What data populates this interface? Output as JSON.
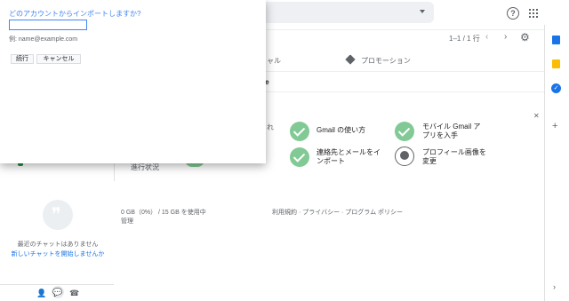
{
  "dialog": {
    "title": "どのアカウントからインポートしますか?",
    "input_value": "",
    "example": "例: name@example.com",
    "continue_label": "続行",
    "cancel_label": "キャンセル"
  },
  "toolbar": {
    "pager": "1–1 / 1 行"
  },
  "tabs": {
    "social_fragment": "ャル",
    "promotions": "プロモーション"
  },
  "message_row": {
    "sender_fragment": "gle"
  },
  "setup": {
    "left_fragment": "れ",
    "items": [
      {
        "label": "Gmail の使い方",
        "done": true
      },
      {
        "label": "モバイル Gmail アプリを入手",
        "done": true
      },
      {
        "label": "連絡先とメールをインポート",
        "done": true
      },
      {
        "label": "プロフィール画像を変更",
        "done": false
      }
    ],
    "status": "進行状況"
  },
  "footer": {
    "storage": "0 GB（0%） / 15 GB を使用中",
    "manage": "管理",
    "links": "利用規約 · プライバシー · プログラム ポリシー"
  },
  "chat": {
    "empty": "最近のチャットはありません",
    "start": "新しいチャットを開始しませんか"
  },
  "colors": {
    "accent_blue": "#4285f4",
    "done_green": "#81c995"
  },
  "icons": [
    "help-icon",
    "apps-icon",
    "settings-icon",
    "label-icon",
    "hangouts-icon",
    "person-icon",
    "chat-icon",
    "phone-icon",
    "calendar-icon",
    "keep-icon",
    "tasks-icon",
    "add-icon"
  ]
}
